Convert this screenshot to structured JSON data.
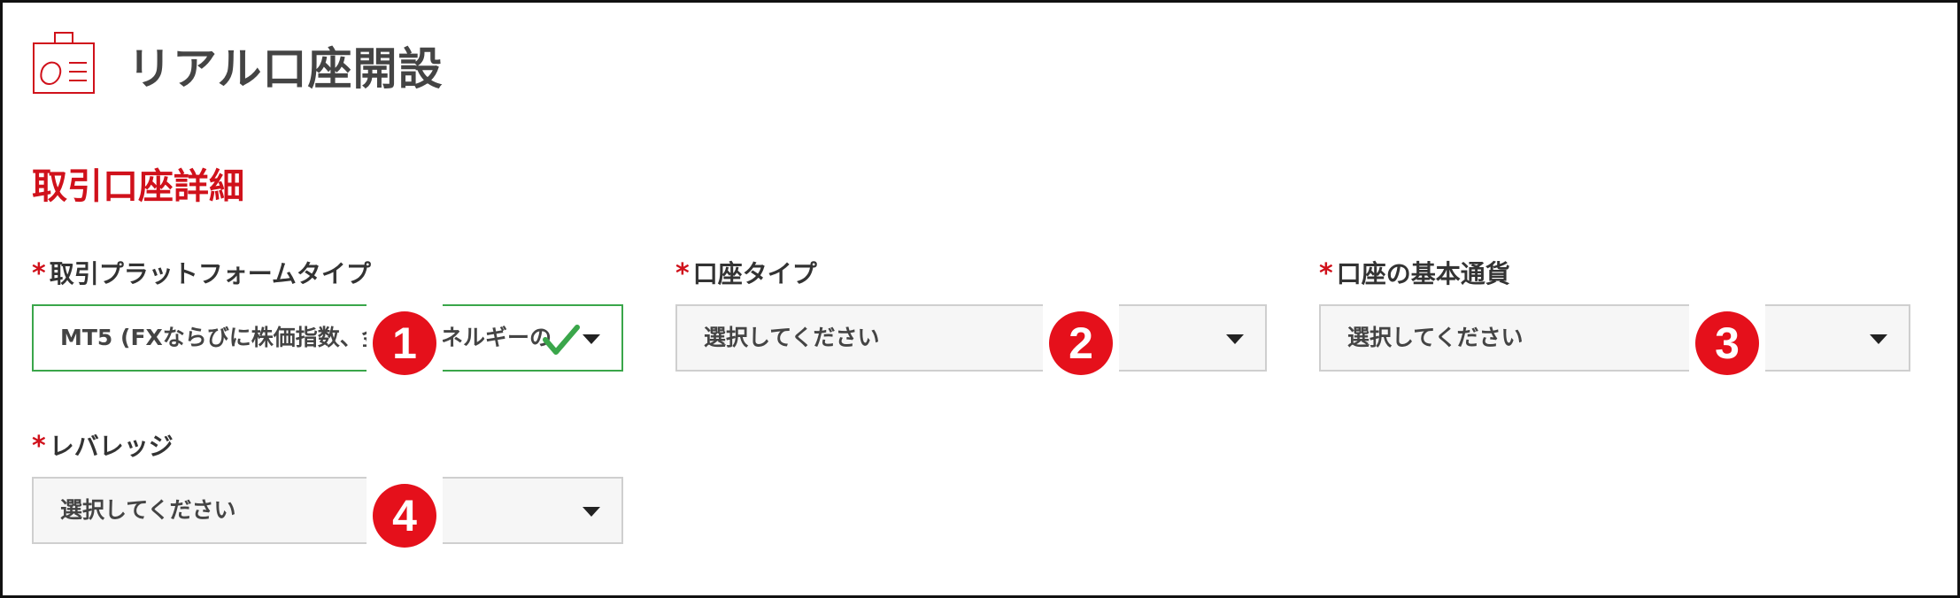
{
  "header": {
    "title": "リアル口座開設",
    "icon": "id-card-icon",
    "icon_color": "#d0111b"
  },
  "section": {
    "title": "取引口座詳細"
  },
  "colors": {
    "accent": "#d0111b",
    "valid": "#3aa64a",
    "badge": "#e5101b"
  },
  "fields": [
    {
      "required_mark": "*",
      "label": "取引プラットフォームタイプ",
      "value": "MT5 (FXならびに株価指数、金",
      "value_suffix": "ネルギーの",
      "state": "valid",
      "step": "1"
    },
    {
      "required_mark": "*",
      "label": "口座タイプ",
      "value": "選択してください",
      "state": "empty",
      "step": "2"
    },
    {
      "required_mark": "*",
      "label": "口座の基本通貨",
      "value": "選択してください",
      "state": "empty",
      "step": "3"
    },
    {
      "required_mark": "*",
      "label": "レバレッジ",
      "value": "選択してください",
      "state": "empty",
      "step": "4"
    }
  ]
}
